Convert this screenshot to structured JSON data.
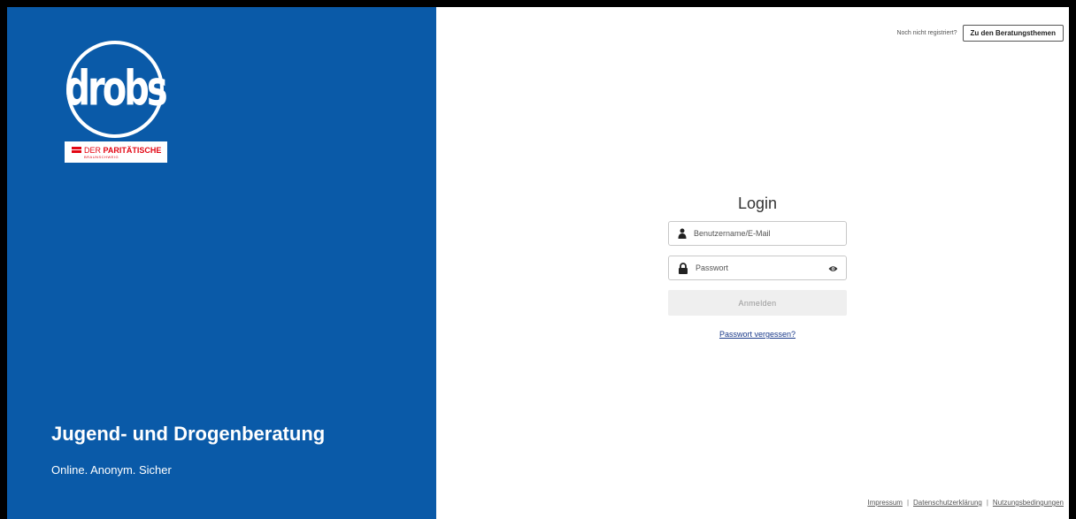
{
  "brand": {
    "logo_text": "drobs",
    "partner_name_part1": "DER ",
    "partner_name_part2": "PARITÄTISCHE",
    "partner_city": "BRAUNSCHWEIG",
    "title": "Jugend- und Drogenberatung",
    "subtitle": "Online. Anonym. Sicher",
    "color": "#0a5aa8"
  },
  "topbar": {
    "hint": "Noch nicht registriert?",
    "topics_button": "Zu den Beratungsthemen"
  },
  "login": {
    "title": "Login",
    "username_placeholder": "Benutzername/E-Mail",
    "password_placeholder": "Passwort",
    "submit_label": "Anmelden",
    "forgot_link": "Passwort vergessen?",
    "username_icon": "user-icon",
    "password_icon": "lock-icon",
    "toggle_icon": "eye-icon"
  },
  "footer": {
    "links": [
      "Impressum",
      "Datenschutzerklärung",
      "Nutzungsbedingungen"
    ],
    "separator": "|"
  }
}
